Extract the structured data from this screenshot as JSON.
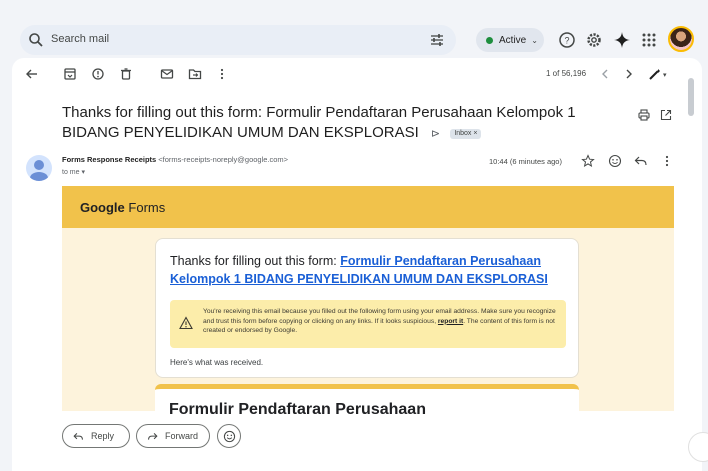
{
  "search": {
    "placeholder": "Search mail"
  },
  "status": {
    "label": "Active",
    "color": "#1e8e3e"
  },
  "toolbar": {
    "pager": "1 of 56,196"
  },
  "email": {
    "subject": "Thanks for filling out this form: Formulir Pendaftaran Perusahaan Kelompok 1 BIDANG PENYELIDIKAN UMUM DAN EKSPLORASI",
    "label_chip": "Inbox ×",
    "sender_name": "Forms Response Receipts",
    "sender_email": "<forms-receipts-noreply@google.com>",
    "to": "to me ▾",
    "time": "10:44 (6 minutes ago)"
  },
  "body": {
    "brand_bold": "Google",
    "brand_rest": " Forms",
    "card_intro": "Thanks for filling out this form: ",
    "card_link": "Formulir Pendaftaran Perusahaan Kelompok 1 BIDANG PENYELIDIKAN UMUM DAN EKSPLORASI",
    "warning_pre": "You're receiving this email because you filled out the following form using your email address. Make sure you recognize and trust this form before copying or clicking on any links. If it looks suspicious, ",
    "warning_link": "report it",
    "warning_post": ". The content of this form is not created or endorsed by Google.",
    "received": "Here's what was received.",
    "form_title": "Formulir Pendaftaran Perusahaan"
  },
  "actions": {
    "reply": "Reply",
    "forward": "Forward"
  },
  "colors": {
    "accent_yellow": "#f1c24b",
    "link_blue": "#1a5fd6",
    "warning_bg": "#fcedaa"
  },
  "icons": [
    "search-icon",
    "filter-icon",
    "help-icon",
    "settings-icon",
    "gemini-icon",
    "apps-icon",
    "back-icon",
    "archive-icon",
    "report-icon",
    "delete-icon",
    "mark-unread-icon",
    "move-icon",
    "more-icon",
    "prev-icon",
    "next-icon",
    "pen-icon",
    "print-icon",
    "popout-icon",
    "star-icon",
    "emoji-icon",
    "reply-icon",
    "more-vert-icon",
    "forward-icon",
    "warning-icon"
  ]
}
